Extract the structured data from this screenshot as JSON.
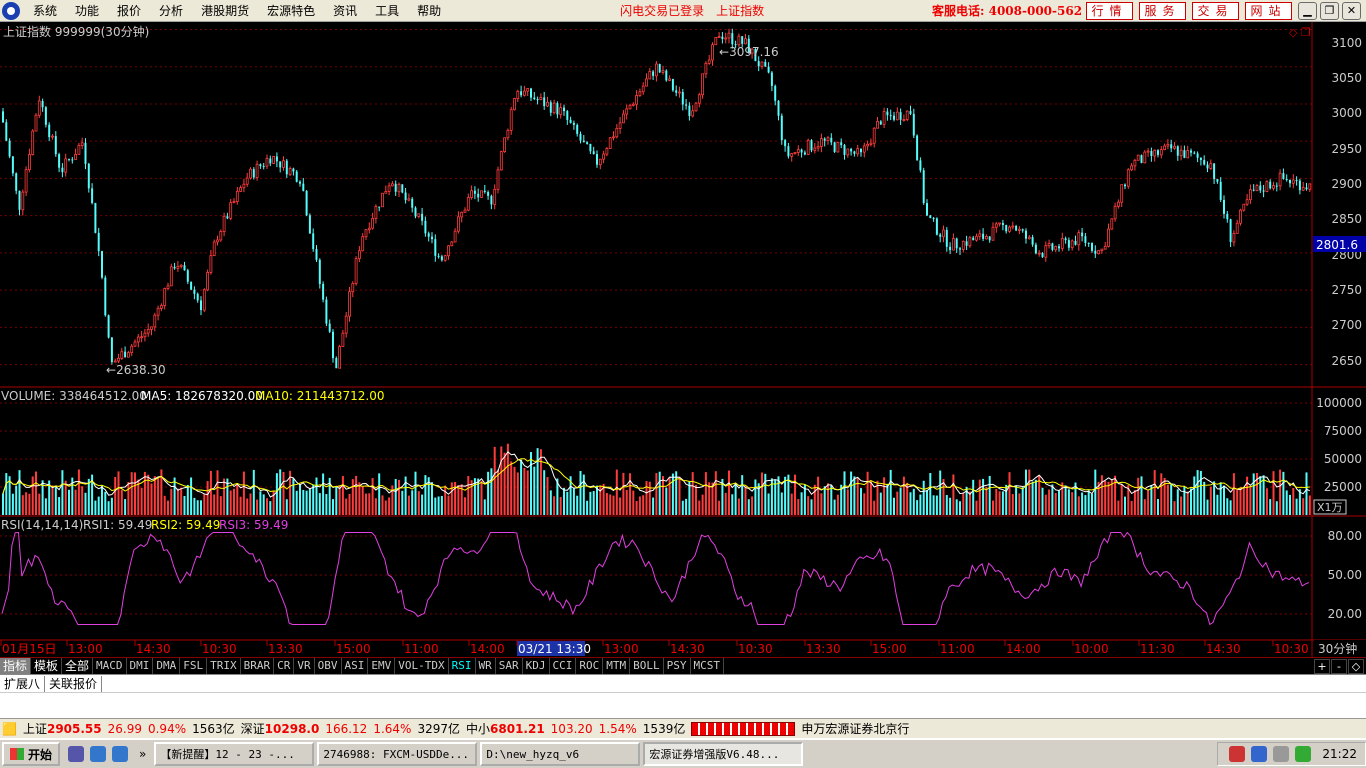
{
  "menu": {
    "items": [
      "系统",
      "功能",
      "报价",
      "分析",
      "港股期货",
      "宏源特色",
      "资讯",
      "工具",
      "帮助"
    ],
    "status": [
      "闪电交易已登录",
      "上证指数"
    ],
    "hotline": "客服电话: 4008-000-562",
    "buttons": [
      "行情",
      "服务",
      "交易",
      "网站"
    ]
  },
  "chart_header": {
    "title": "上证指数 999999(30分钟)",
    "high_label": "3097.16",
    "low_label": "2638.30",
    "current_tag": "2801.6"
  },
  "price_axis": [
    "3100",
    "3050",
    "3000",
    "2950",
    "2900",
    "2850",
    "2800",
    "2750",
    "2700",
    "2650"
  ],
  "volume_header": {
    "label": "VOLUME: 338464512.00",
    "ma5": "MA5: 182678320.00",
    "ma10": "MA10: 211443712.00"
  },
  "volume_axis": [
    "100000",
    "75000",
    "50000",
    "25000"
  ],
  "volume_unit": "X1万",
  "rsi_header": {
    "label": "RSI(14,14,14)",
    "rsi1": "RSI1: 59.49",
    "rsi2": "RSI2: 59.49",
    "rsi3": "RSI3: 59.49"
  },
  "rsi_axis": [
    "80.00",
    "50.00",
    "20.00"
  ],
  "time_axis": [
    "01月15日",
    "13:00",
    "14:30",
    "10:30",
    "13:30",
    "15:00",
    "11:00",
    "14:00",
    "03/21 13:30",
    "13:00",
    "14:30",
    "10:30",
    "13:30",
    "15:00",
    "11:00",
    "14:00",
    "10:00",
    "11:30",
    "14:30",
    "10:30"
  ],
  "period_label": "30分钟",
  "tabs": [
    "指标",
    "模板",
    "全部",
    "MACD",
    "DMI",
    "DMA",
    "FSL",
    "TRIX",
    "BRAR",
    "CR",
    "VR",
    "OBV",
    "ASI",
    "EMV",
    "VOL-TDX",
    "RSI",
    "WR",
    "SAR",
    "KDJ",
    "CCI",
    "ROC",
    "MTM",
    "BOLL",
    "PSY",
    "MCST"
  ],
  "active_tab": "RSI",
  "tab_controls": [
    "+",
    "-",
    "◇"
  ],
  "ext_tabs": [
    "扩展八",
    "关联报价"
  ],
  "ticker": {
    "sh_label": "上证",
    "sh_val": "2905.55",
    "sh_chg": "26.99",
    "sh_pct": "0.94%",
    "sh_amt": "1563亿",
    "sz_label": "深证",
    "sz_val": "10298.0",
    "sz_chg": "166.12",
    "sz_pct": "1.64%",
    "sz_amt": "3297亿",
    "zx_label": "中小",
    "zx_val": "6801.21",
    "zx_chg": "103.20",
    "zx_pct": "1.54%",
    "zx_amt": "1539亿",
    "broker": "申万宏源证券北京行"
  },
  "taskbar": {
    "start": "开始",
    "windows": [
      "【新提醒】12 - 23 -...",
      "2746988: FXCM-USDDe...",
      "D:\\new_hyzq_v6",
      "宏源证券增强版V6.48..."
    ],
    "clock": "21:22"
  },
  "chart_data": {
    "type": "candlestick",
    "ylim": [
      2620,
      3110
    ],
    "volume_ylim": [
      0,
      110000
    ],
    "rsi_ylim": [
      0,
      100
    ]
  }
}
